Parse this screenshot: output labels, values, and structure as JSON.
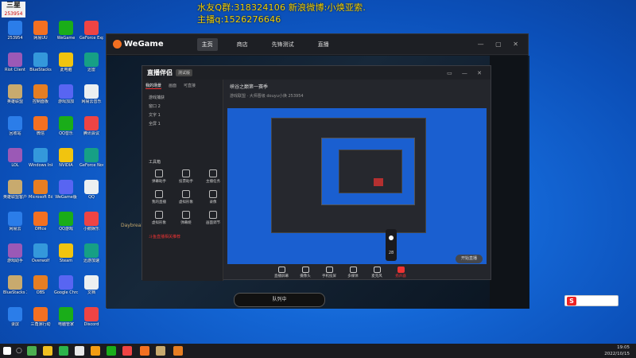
{
  "overlay": {
    "line1": "水友Q群:318324106 新浪微博:小焕亚索.",
    "line2": "主播q:1526276646"
  },
  "corner_logo": {
    "title": "三星",
    "sub": "253954"
  },
  "desktop_icons": [
    "253954",
    "网易UU",
    "WeGame",
    "GeForce Experience",
    "Riot Client",
    "BlueStacks",
    "此电脑",
    "迅雷",
    "英雄联盟",
    "控制面板",
    "游戏加加",
    "网易云音乐",
    "回收站",
    "微信",
    "QQ音乐",
    "腾讯会议",
    "LOL",
    "Windows Ink",
    "NVIDIA",
    "GeForce Now",
    "英雄联盟客户端",
    "Microsoft Edge",
    "WeGame版",
    "QQ",
    "网易云",
    "Office",
    "QQ游戏",
    "小鹅娱乐",
    "游戏助手",
    "Overwolf",
    "Steam",
    "迅游加速",
    "BlueStacks X",
    "OBS",
    "Google Chrome",
    "文档",
    "录屏",
    "三角洲行动",
    "电脑管家",
    "Discord"
  ],
  "wegame": {
    "logo": "WeGame",
    "nav": [
      "主页",
      "商店",
      "先锋测试",
      "直播"
    ],
    "bottom_label": "队列中",
    "side_text": "Daybreak"
  },
  "live_app": {
    "title": "直播伴侣",
    "version": "测试版",
    "tabs": [
      "我的场景",
      "画面",
      "可直接"
    ],
    "sources": [
      "游戏捕获",
      "窗口 2",
      "文字 1",
      "全屏 1"
    ],
    "tools_title": "工具箱",
    "tools": [
      "弹幕助手",
      "投票助手",
      "主播任务",
      "我的直播",
      "虚拟形象",
      "录像",
      "虚拟形象",
      "弹幕姬",
      "画面调节"
    ],
    "quick_tip": "斗鱼直播相关推荐",
    "room_title": "峡谷之巅第一赛季",
    "room_sub": "游戏联盟 · 大师晋级  douyu小焕  253954",
    "controls": [
      "直播屏幕",
      "摄像头",
      "手机投屏",
      "多媒体",
      "麦克风",
      "扬声器"
    ],
    "start_label": "开始直播",
    "volume_value": "28"
  },
  "tray": {
    "time": "19:05",
    "date": "2022/10/15"
  },
  "colors": {
    "overlay": "#f5d000",
    "accent": "#e33333",
    "wegame_orange": "#f37021"
  }
}
